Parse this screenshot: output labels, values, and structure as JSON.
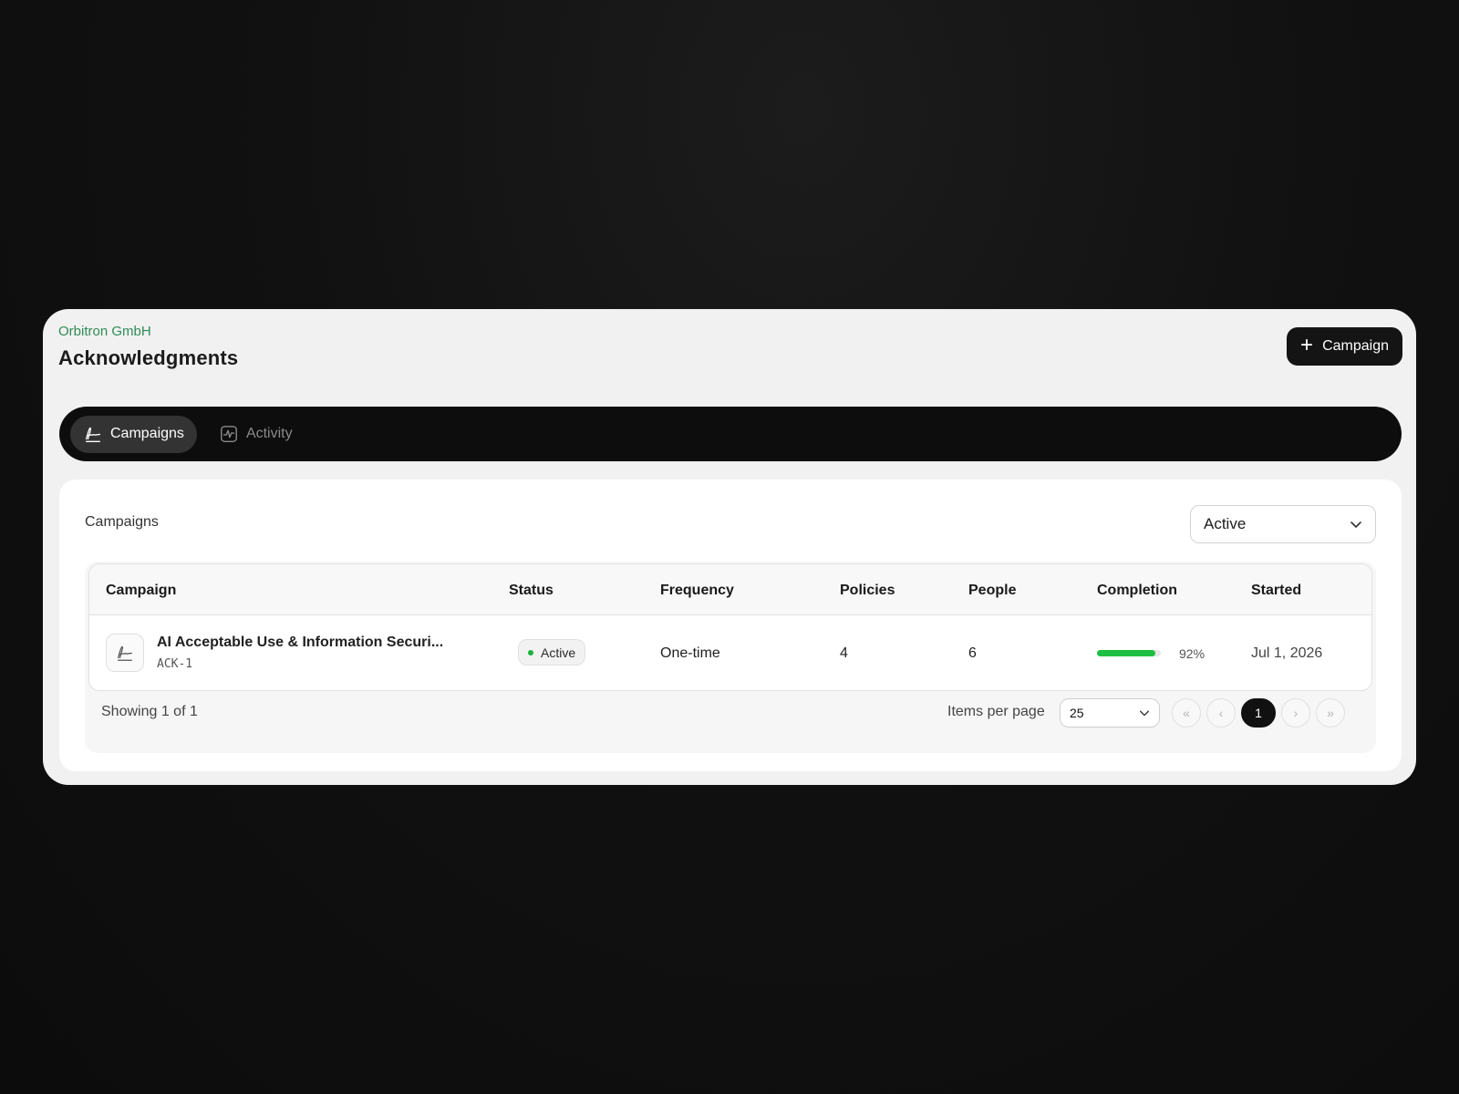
{
  "header": {
    "org": "Orbitron GmbH",
    "title": "Acknowledgments",
    "new_button_label": "Campaign"
  },
  "tabs": [
    {
      "label": "Campaigns",
      "icon": "signature-icon",
      "active": true
    },
    {
      "label": "Activity",
      "icon": "activity-icon",
      "active": false
    }
  ],
  "panel": {
    "title": "Campaigns",
    "status_filter": "Active"
  },
  "table": {
    "columns": [
      "Campaign",
      "Status",
      "Frequency",
      "Policies",
      "People",
      "Completion",
      "Started"
    ],
    "rows": [
      {
        "name": "AI Acceptable Use & Information Securi...",
        "id": "ACK-1",
        "status": "Active",
        "frequency": "One-time",
        "policies": "4",
        "people": "6",
        "completion": "92%",
        "completion_value": 92,
        "started": "Jul 1, 2026"
      }
    ]
  },
  "footer": {
    "showing": "Showing 1 of 1",
    "items_per_page_label": "Items per page",
    "items_per_page": "25",
    "current_page": "1"
  },
  "colors": {
    "accent_green": "#1cbf41",
    "org_green": "#2e8b57",
    "dark": "#141414"
  }
}
